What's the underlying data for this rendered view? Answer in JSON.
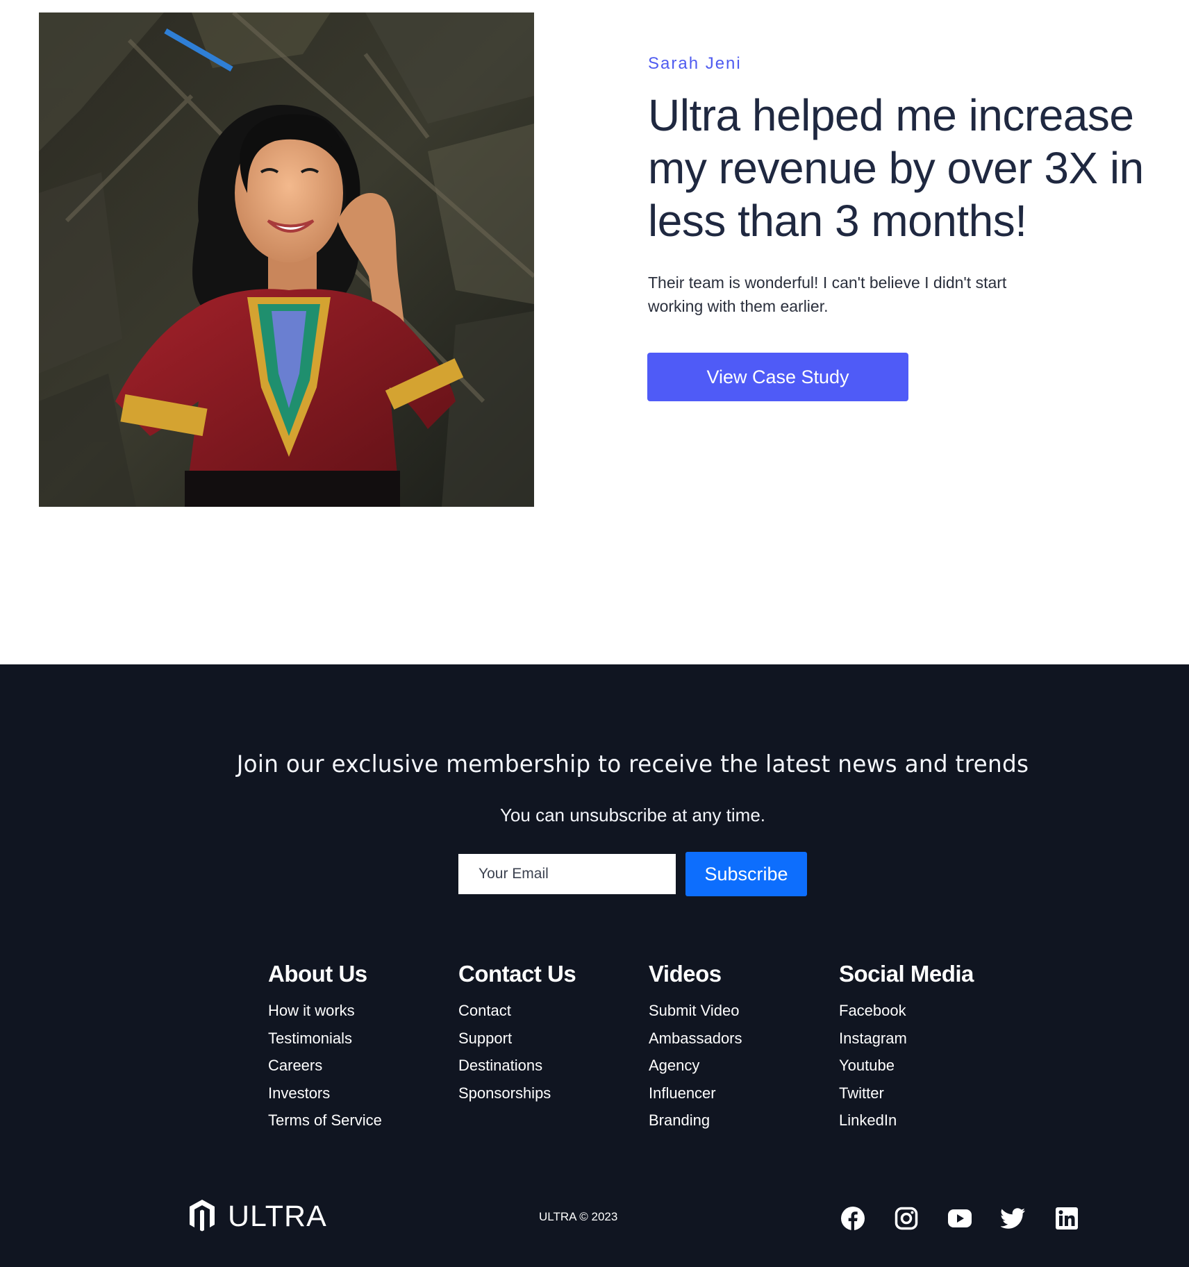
{
  "testimonial": {
    "name": "Sarah Jeni",
    "headline": "Ultra helped me increase my revenue by over 3X in less than 3 months!",
    "body": "Their team is wonderful! I can't believe I didn't start working with them earlier.",
    "cta_label": "View Case Study"
  },
  "newsletter": {
    "headline": "Join our exclusive membership to receive the latest news and trends",
    "subtext": "You can unsubscribe at any time.",
    "email_placeholder": "Your Email",
    "subscribe_label": "Subscribe"
  },
  "footer_columns": [
    {
      "title": "About Us",
      "links": [
        "How it works",
        "Testimonials",
        "Careers",
        "Investors",
        "Terms of Service"
      ]
    },
    {
      "title": "Contact Us",
      "links": [
        "Contact",
        "Support",
        "Destinations",
        "Sponsorships"
      ]
    },
    {
      "title": "Videos",
      "links": [
        "Submit Video",
        "Ambassadors",
        "Agency",
        "Influencer",
        "Branding"
      ]
    },
    {
      "title": "Social Media",
      "links": [
        "Facebook",
        "Instagram",
        "Youtube",
        "Twitter",
        "LinkedIn"
      ]
    }
  ],
  "brand": {
    "name": "ULTRA",
    "copyright": "ULTRA © 2023"
  },
  "social_icons": [
    "facebook-icon",
    "instagram-icon",
    "youtube-icon",
    "twitter-icon",
    "linkedin-icon"
  ],
  "colors": {
    "accent": "#4f5bf7",
    "subscribe_blue": "#0d6efd",
    "footer_bg": "#101521",
    "heading_text": "#1f2840"
  }
}
